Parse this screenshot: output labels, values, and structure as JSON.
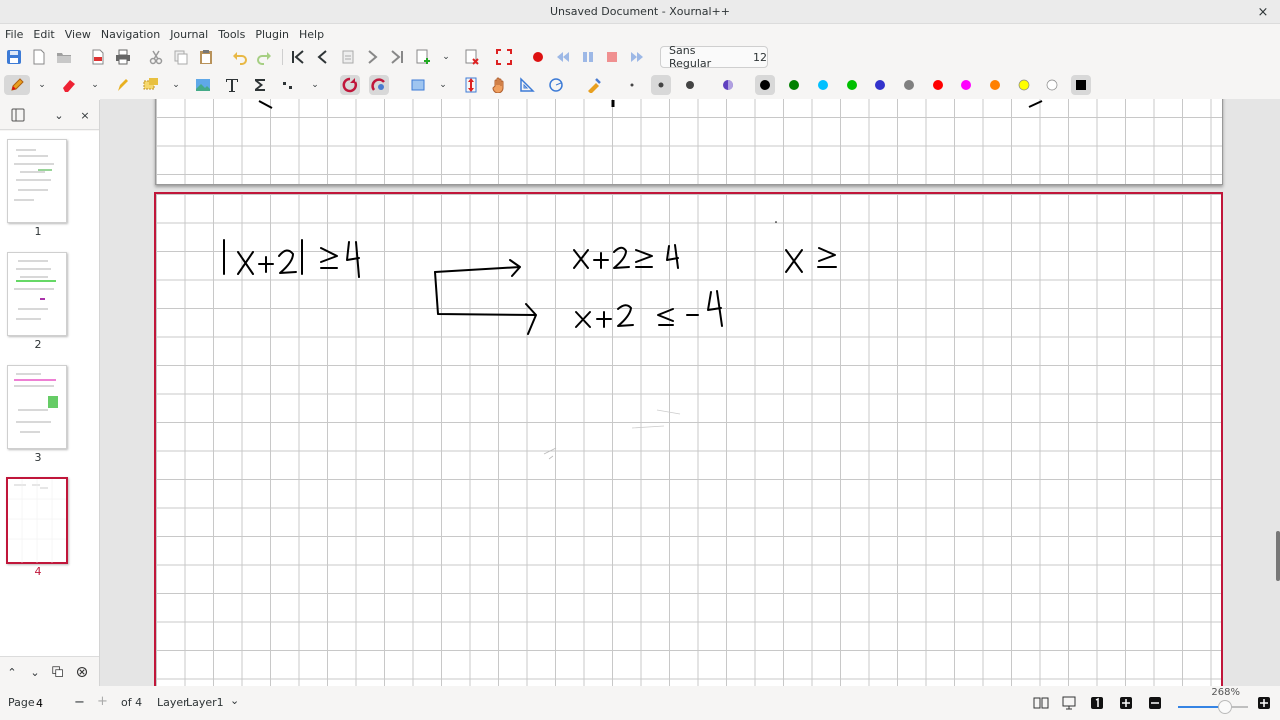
{
  "window": {
    "title": "Unsaved Document - Xournal++",
    "close_glyph": "×"
  },
  "menu": [
    "File",
    "Edit",
    "View",
    "Navigation",
    "Journal",
    "Tools",
    "Plugin",
    "Help"
  ],
  "toolbar": {
    "font_name": "Sans Regular",
    "font_size": "12",
    "colors": [
      "#000000",
      "#008000",
      "#00c0ff",
      "#00c000",
      "#3333cc",
      "#808080",
      "#ff0000",
      "#ff00ff",
      "#ff8000",
      "#ffff00",
      "#ffffff"
    ]
  },
  "sidebar": {
    "close_glyph": "×",
    "pages": [
      "1",
      "2",
      "3",
      "4"
    ],
    "selected_page": "4"
  },
  "status": {
    "page_label": "Page",
    "page_value": "4",
    "minus": "−",
    "plus": "+",
    "of_total": "of 4",
    "layer_label": "Layer",
    "layer_value": "Layer1",
    "zoom": "268%"
  },
  "accent": "#c0163a",
  "icons": {
    "zoom_in": "plus-icon",
    "zoom_out": "minus-icon"
  }
}
